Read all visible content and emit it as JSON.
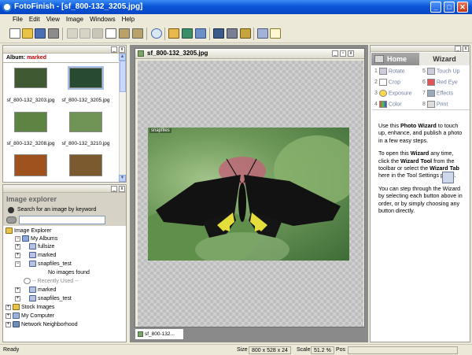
{
  "window": {
    "title": "FotoFinish - [sf_800-132_3205.jpg]",
    "controls": {
      "minimize": "_",
      "maximize": "□",
      "close": "✕"
    }
  },
  "menu": [
    "File",
    "Edit",
    "View",
    "Image",
    "Windows",
    "Help"
  ],
  "album": {
    "label": "Album:",
    "name": "marked",
    "thumbnails": [
      {
        "caption": "sf_800-132_3203.jpg",
        "color": "#3f5a32"
      },
      {
        "caption": "sf_800-132_3205.jpg",
        "color": "#284a32"
      },
      {
        "caption": "sf_800-132_3208.jpg",
        "color": "#5d8443"
      },
      {
        "caption": "sf_800-132_3210.jpg",
        "color": "#6f9455"
      },
      {
        "caption": "",
        "color": "#a0521e"
      },
      {
        "caption": "",
        "color": "#7a5a2e"
      }
    ]
  },
  "explorer": {
    "title": "Image explorer",
    "search_label": "Search for an image by keyword",
    "search_value": "",
    "tree": [
      {
        "label": "Image Explorer",
        "indent": 0,
        "pm": "",
        "icon": "folder-icon"
      },
      {
        "label": "My Albums",
        "indent": 1,
        "pm": "−",
        "icon": "albums-icon"
      },
      {
        "label": "fullsize",
        "indent": 2,
        "pm": "+",
        "icon": "album-icon"
      },
      {
        "label": "marked",
        "indent": 2,
        "pm": "+",
        "icon": "album-icon"
      },
      {
        "label": "snapfiles_test",
        "indent": 2,
        "pm": "−",
        "icon": "album-icon"
      },
      {
        "label": "No images found",
        "indent": 4,
        "pm": "",
        "icon": ""
      },
      {
        "label": "-- Recently Used --",
        "indent": 2,
        "pm": "",
        "icon": "clock-icon"
      },
      {
        "label": "marked",
        "indent": 2,
        "pm": "+",
        "icon": "album-icon"
      },
      {
        "label": "snapfiles_test",
        "indent": 2,
        "pm": "+",
        "icon": "album-icon"
      },
      {
        "label": "Stock Images",
        "indent": 1,
        "pm": "+",
        "icon": "folder-icon"
      },
      {
        "label": "My Computer",
        "indent": 1,
        "pm": "+",
        "icon": "computer-icon"
      },
      {
        "label": "Network Neighborhood",
        "indent": 1,
        "pm": "+",
        "icon": "network-icon"
      }
    ]
  },
  "document": {
    "title": "sf_800-132_3205.jpg",
    "watermark": "snapfiles",
    "tab_label": "sf_800-132..."
  },
  "wizard": {
    "tabs": {
      "home": "Home",
      "wizard": "Wizard"
    },
    "steps": [
      {
        "num": "1",
        "label": "Rotate"
      },
      {
        "num": "5",
        "label": "Touch Up"
      },
      {
        "num": "2",
        "label": "Crop"
      },
      {
        "num": "6",
        "label": "Red Eye"
      },
      {
        "num": "3",
        "label": "Exposure"
      },
      {
        "num": "7",
        "label": "Effects"
      },
      {
        "num": "4",
        "label": "Color"
      },
      {
        "num": "8",
        "label": "Print"
      }
    ],
    "help": {
      "p1a": "Use this ",
      "p1b": "Photo Wizard",
      "p1c": " to touch up, enhance, and publish a photo in a few easy steps.",
      "p2a": "To open this ",
      "p2b": "Wizard",
      "p2c": " any time, click the ",
      "p2d": "Wizard Tool",
      "p2e": " from the toolbar or select the ",
      "p2f": "Wizard Tab",
      "p2g": " here in the Tool Settings panel.",
      "p3": "You can step through the Wizard by selecting each button above in order, or by simply choosing any button directly."
    }
  },
  "status": {
    "ready": "Ready",
    "size_label": "Size",
    "size_value": "800 x 528 x 24",
    "scale_label": "Scale",
    "scale_value": "51.2 %",
    "pos_label": "Pos"
  }
}
